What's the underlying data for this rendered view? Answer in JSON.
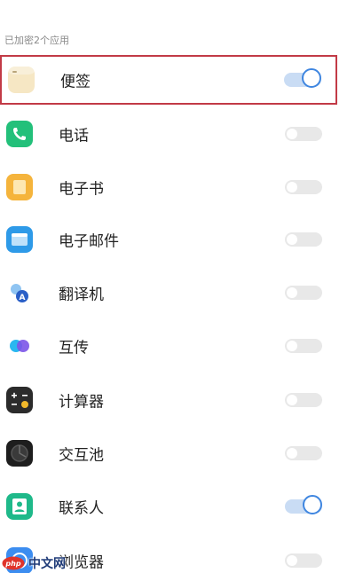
{
  "section": {
    "title": "已加密2个应用"
  },
  "apps": [
    {
      "label": "便签",
      "icon": "notes-icon",
      "enabled": true,
      "highlighted": true
    },
    {
      "label": "电话",
      "icon": "phone-icon",
      "enabled": false
    },
    {
      "label": "电子书",
      "icon": "ebook-icon",
      "enabled": false
    },
    {
      "label": "电子邮件",
      "icon": "email-icon",
      "enabled": false
    },
    {
      "label": "翻译机",
      "icon": "translator-icon",
      "enabled": false
    },
    {
      "label": "互传",
      "icon": "transfer-icon",
      "enabled": false
    },
    {
      "label": "计算器",
      "icon": "calculator-icon",
      "enabled": false
    },
    {
      "label": "交互池",
      "icon": "pool-icon",
      "enabled": false
    },
    {
      "label": "联系人",
      "icon": "contacts-icon",
      "enabled": true
    },
    {
      "label": "浏览器",
      "icon": "browser-icon",
      "enabled": false
    }
  ],
  "watermark": {
    "text": "中文网",
    "logo": "php"
  },
  "colors": {
    "highlight_border": "#c23a46",
    "toggle_on_track": "#c9dcf4",
    "toggle_on_knob_ring": "#3f86e0",
    "toggle_off_track": "#e8e8e8"
  }
}
